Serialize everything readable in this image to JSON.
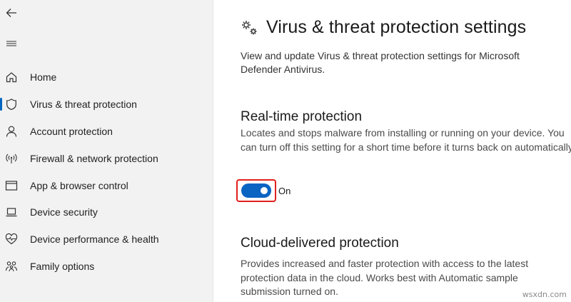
{
  "sidebar": {
    "back_icon": "back-arrow-icon",
    "menu_icon": "hamburger-icon",
    "items": [
      {
        "label": "Home",
        "icon": "home-icon"
      },
      {
        "label": "Virus & threat protection",
        "icon": "shield-icon",
        "active": true
      },
      {
        "label": "Account protection",
        "icon": "person-icon"
      },
      {
        "label": "Firewall & network protection",
        "icon": "wifi-antenna-icon"
      },
      {
        "label": "App & browser control",
        "icon": "app-window-icon"
      },
      {
        "label": "Device security",
        "icon": "laptop-icon"
      },
      {
        "label": "Device performance & health",
        "icon": "heart-pulse-icon"
      },
      {
        "label": "Family options",
        "icon": "family-icon"
      }
    ]
  },
  "main": {
    "title": "Virus & threat protection settings",
    "title_icon": "gears-icon",
    "description": "View and update Virus & threat protection settings for Microsoft Defender Antivirus.",
    "realtime": {
      "title": "Real-time protection",
      "description": "Locates and stops malware from installing or running on your device. You can turn off this setting for a short time before it turns back on automatically.",
      "toggle_state": "On",
      "toggle_on": true
    },
    "cloud": {
      "title": "Cloud-delivered protection",
      "description": "Provides increased and faster protection with access to the latest protection data in the cloud. Works best with Automatic sample submission turned on."
    }
  },
  "watermark": "wsxdn.com",
  "colors": {
    "accent": "#0a64c2",
    "highlight_border": "#e0201b",
    "sidebar_bg": "#f2f2f2"
  }
}
